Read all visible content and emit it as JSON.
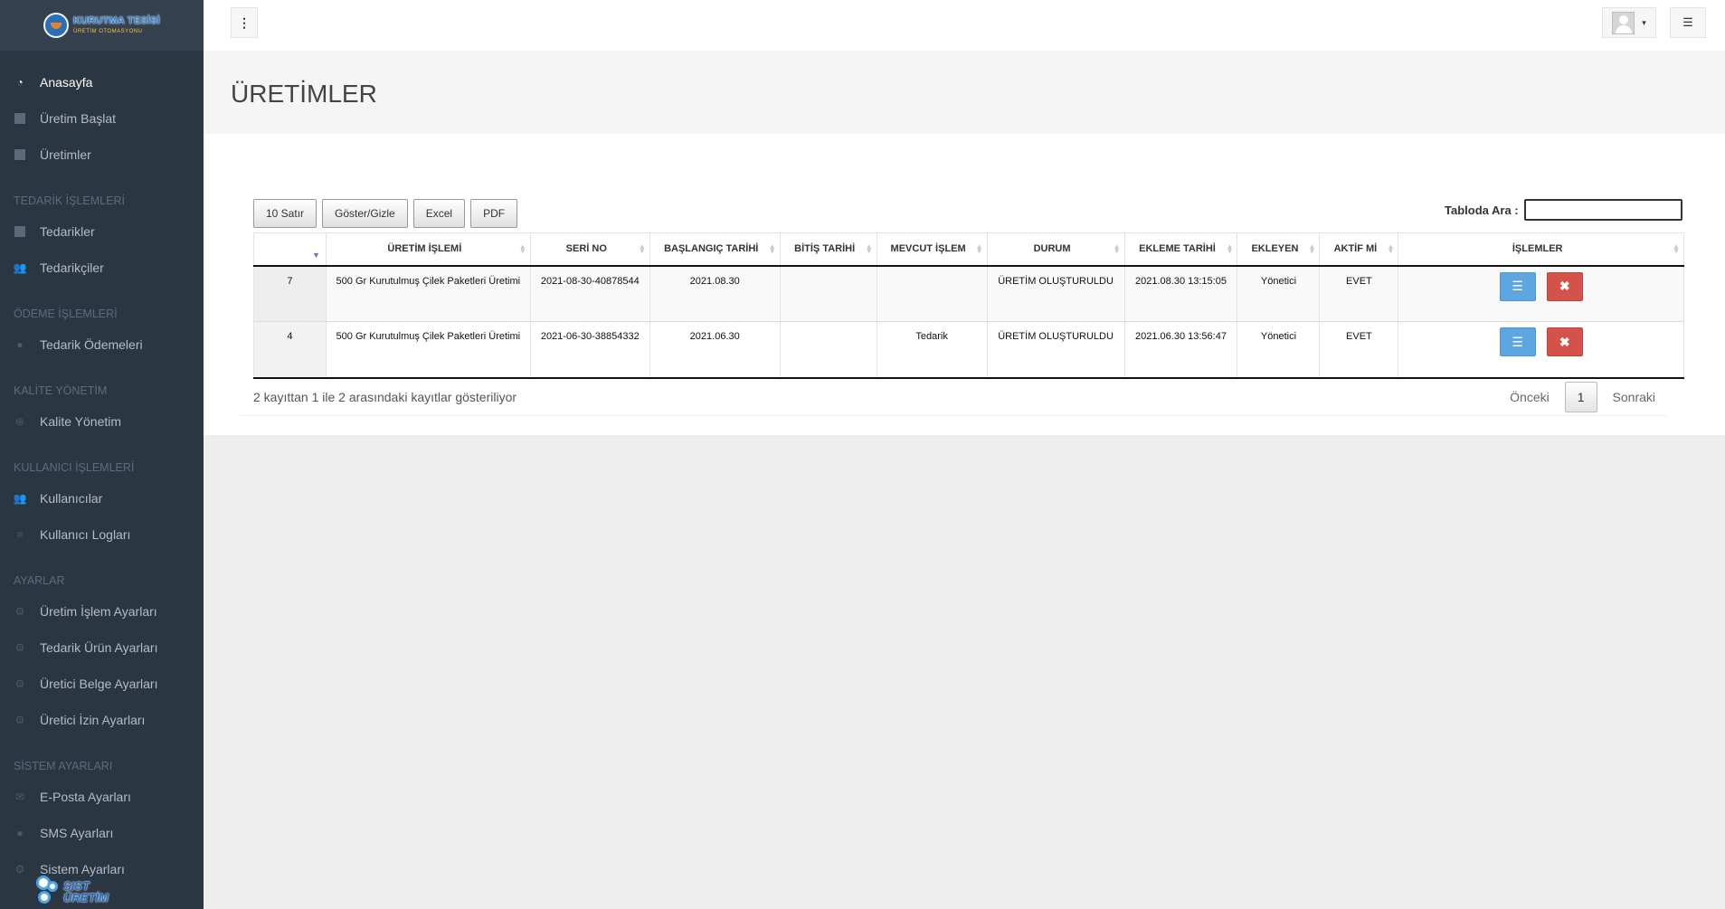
{
  "brand": {
    "logo_title": "KURUTMA TESİSİ",
    "logo_sub": "ÜRETİM OTOMASYONU",
    "footer_logo_line1": "SIST",
    "footer_logo_line2": "ÜRETİM"
  },
  "sidebar": {
    "items": [
      {
        "label": "Anasayfa"
      },
      {
        "label": "Üretim Başlat"
      },
      {
        "label": "Üretimler"
      }
    ],
    "sections": [
      {
        "heading": "TEDARİK İŞLEMLERİ",
        "items": [
          {
            "label": "Tedarikler"
          },
          {
            "label": "Tedarikçiler"
          }
        ]
      },
      {
        "heading": "ÖDEME İŞLEMLERİ",
        "items": [
          {
            "label": "Tedarik Ödemeleri"
          }
        ]
      },
      {
        "heading": "KALİTE YÖNETİM",
        "items": [
          {
            "label": "Kalite Yönetim"
          }
        ]
      },
      {
        "heading": "KULLANICI İŞLEMLERİ",
        "items": [
          {
            "label": "Kullanıcılar"
          },
          {
            "label": "Kullanıcı Logları"
          }
        ]
      },
      {
        "heading": "AYARLAR",
        "items": [
          {
            "label": "Üretim İşlem Ayarları"
          },
          {
            "label": "Tedarik Ürün Ayarları"
          },
          {
            "label": "Üretici Belge Ayarları"
          },
          {
            "label": "Üretici İzin Ayarları"
          }
        ]
      },
      {
        "heading": "SİSTEM AYARLARI",
        "items": [
          {
            "label": "E-Posta Ayarları"
          },
          {
            "label": "SMS Ayarları"
          },
          {
            "label": "Sistem Ayarları"
          }
        ]
      }
    ]
  },
  "page": {
    "title": "ÜRETİMLER"
  },
  "toolbar": {
    "rows_label": "10 Satır",
    "toggle_label": "Göster/Gizle",
    "excel_label": "Excel",
    "pdf_label": "PDF",
    "search_label": "Tabloda Ara :",
    "search_value": ""
  },
  "table": {
    "columns": [
      "",
      "ÜRETİM İŞLEMİ",
      "SERİ NO",
      "BAŞLANGIÇ TARİHİ",
      "BİTİŞ TARİHİ",
      "MEVCUT İŞLEM",
      "DURUM",
      "EKLEME TARİHİ",
      "EKLEYEN",
      "AKTİF Mİ",
      "İŞLEMLER"
    ],
    "rows": [
      {
        "id": "7",
        "islem": "500 Gr Kurutulmuş Çilek Paketleri Üretimi",
        "seri": "2021-08-30-40878544",
        "baslangic": "2021.08.30",
        "bitis": "",
        "mevcut": "",
        "durum": "ÜRETİM OLUŞTURULDU",
        "ekleme": "2021.08.30 13:15:05",
        "ekleyen": "Yönetici",
        "aktif": "EVET"
      },
      {
        "id": "4",
        "islem": "500 Gr Kurutulmuş Çilek Paketleri Üretimi",
        "seri": "2021-06-30-38854332",
        "baslangic": "2021.06.30",
        "bitis": "",
        "mevcut": "Tedarik",
        "durum": "ÜRETİM OLUŞTURULDU",
        "ekleme": "2021.06.30 13:56:47",
        "ekleyen": "Yönetici",
        "aktif": "EVET"
      }
    ]
  },
  "footer": {
    "info": "2 kayıttan 1 ile 2 arasındaki kayıtlar gösteriliyor",
    "prev": "Önceki",
    "current_page": "1",
    "next": "Sonraki"
  },
  "icons": {
    "dashboard": "◔",
    "toggler": "⋮",
    "caret": "▾",
    "quick_sidebar": "☰",
    "list": "☰",
    "delete": "✖",
    "sort_asc": "▲",
    "sort_desc": "▼",
    "sort_active": "▼",
    "users": "👥",
    "money": "●",
    "quality": "⊛",
    "logs": "≡",
    "settings": "⚙",
    "mail": "✉",
    "sms": "●"
  }
}
